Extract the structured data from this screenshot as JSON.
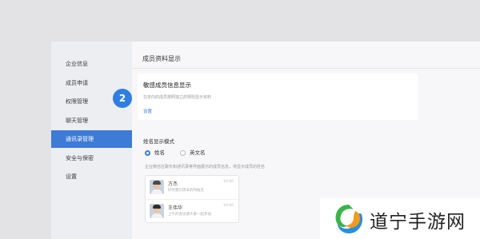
{
  "sidebar": {
    "items": [
      {
        "label": "企业信息"
      },
      {
        "label": "成员申请"
      },
      {
        "label": "权限管理"
      },
      {
        "label": "聊天管理"
      },
      {
        "label": "通讯录管理",
        "active": true
      },
      {
        "label": "安全与保密"
      },
      {
        "label": "设置"
      }
    ]
  },
  "main": {
    "section_title": "成员资料显示",
    "sensitive_card": {
      "title": "敏感成员信息显示",
      "description": "在单内的成员按照独立的规则显示资料",
      "link": "设置"
    },
    "step_badge": "2",
    "name_mode": {
      "title": "姓名显示模式",
      "options": [
        {
          "label": "姓名",
          "checked": true
        },
        {
          "label": "英文名",
          "checked": false
        }
      ],
      "description": "企业微信在聊天和通讯录等界面展示的成员信息，将显示成员的姓名"
    },
    "preview": [
      {
        "name": "方杰",
        "message": "好的我们周末的时候见",
        "time": "10:00"
      },
      {
        "name": "王伟华",
        "message": "上午的会议请大家一起参加",
        "time": "10:00"
      }
    ]
  },
  "watermark": {
    "text": "道宁手游网",
    "colors": {
      "green": "#3bb34a",
      "blue": "#2c8fd6",
      "orange": "#f39a1e"
    }
  },
  "colors": {
    "accent": "#3d7bd6",
    "badge": "#2f7fe3"
  }
}
